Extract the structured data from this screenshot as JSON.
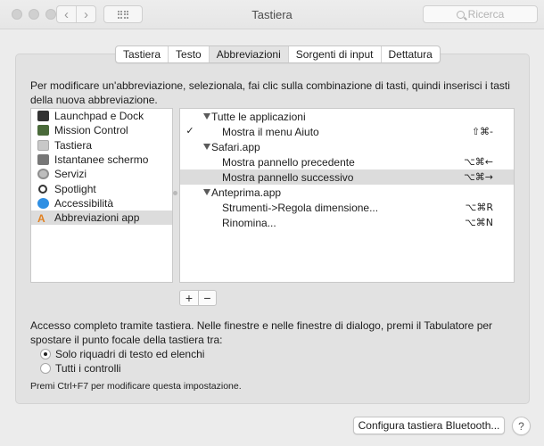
{
  "window": {
    "title": "Tastiera"
  },
  "search": {
    "placeholder": "Ricerca"
  },
  "tabs": [
    {
      "label": "Tastiera",
      "active": false
    },
    {
      "label": "Testo",
      "active": false
    },
    {
      "label": "Abbreviazioni",
      "active": true
    },
    {
      "label": "Sorgenti di input",
      "active": false
    },
    {
      "label": "Dettatura",
      "active": false
    }
  ],
  "intro": "Per modificare un'abbreviazione, selezionala, fai clic sulla combinazione di tasti, quindi inserisci i tasti della nuova abbreviazione.",
  "categories": [
    {
      "label": "Launchpad e Dock",
      "icon": "launchpad-icon"
    },
    {
      "label": "Mission Control",
      "icon": "mission-control-icon"
    },
    {
      "label": "Tastiera",
      "icon": "keyboard-icon"
    },
    {
      "label": "Istantanee schermo",
      "icon": "screenshot-icon"
    },
    {
      "label": "Servizi",
      "icon": "services-gear-icon"
    },
    {
      "label": "Spotlight",
      "icon": "spotlight-icon"
    },
    {
      "label": "Accessibilità",
      "icon": "accessibility-icon"
    },
    {
      "label": "Abbreviazioni app",
      "icon": "app-shortcuts-icon",
      "selected": true
    }
  ],
  "shortcuts": {
    "group_all": "Tutte le applicazioni",
    "item_help": {
      "label": "Mostra il menu Aiuto",
      "keys": "⇧⌘-",
      "checked": true
    },
    "group_safari": "Safari.app",
    "item_prev": {
      "label": "Mostra pannello precedente",
      "keys": "⌥⌘←"
    },
    "item_next": {
      "label": "Mostra pannello successivo",
      "keys": "⌥⌘→"
    },
    "group_preview": "Anteprima.app",
    "item_resize": {
      "label": "Strumenti->Regola dimensione...",
      "keys": "⌥⌘R"
    },
    "item_rename": {
      "label": "Rinomina...",
      "keys": "⌥⌘N"
    }
  },
  "buttons": {
    "add": "+",
    "remove": "−",
    "bluetooth": "Configura tastiera Bluetooth...",
    "help": "?"
  },
  "access": {
    "text": "Accesso completo tramite tastiera. Nelle finestre e nelle finestre di dialogo, premi il Tabulatore per spostare il punto focale della tastiera tra:",
    "option_text_lists": "Solo riquadri di testo ed elenchi",
    "option_all_controls": "Tutti i controlli",
    "hint": "Premi Ctrl+F7 per modificare questa impostazione."
  }
}
